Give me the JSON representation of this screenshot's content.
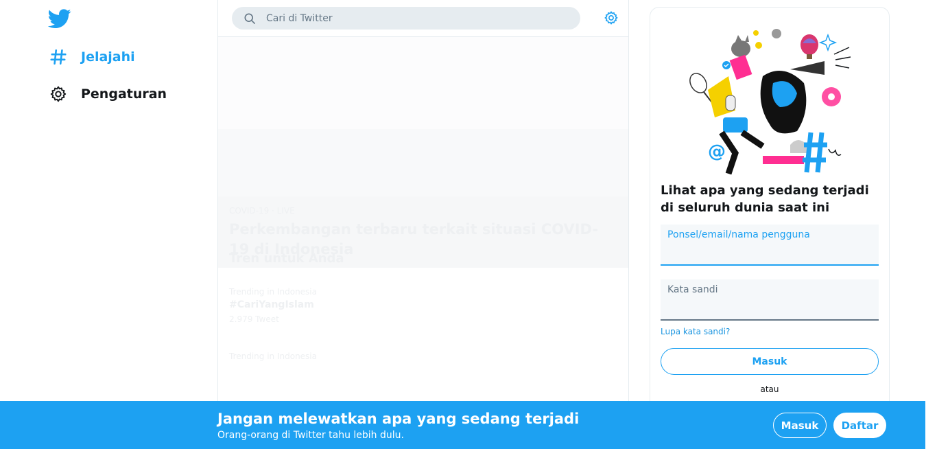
{
  "nav": {
    "items": [
      {
        "label": "Jelajahi",
        "icon": "hashtag-icon"
      },
      {
        "label": "Pengaturan",
        "icon": "gear-icon"
      }
    ]
  },
  "search": {
    "placeholder": "Cari di Twitter"
  },
  "main": {
    "hero_category": "COVID-19 · LIVE",
    "hero_title": "Perkembangan terbaru terkait situasi COVID-19 di Indonesia",
    "trends_heading": "Tren untuk Anda",
    "trend1_meta": "Trending in Indonesia",
    "trend1_name": "#CariYangIslam",
    "trend1_count": "2.979 Tweet",
    "trend2_meta": "Trending in Indonesia"
  },
  "login": {
    "heading": "Lihat apa yang sedang terjadi di seluruh dunia saat ini",
    "username_label": "Ponsel/email/nama pengguna",
    "password_label": "Kata sandi",
    "forgot": "Lupa kata sandi?",
    "submit": "Masuk",
    "or": "atau"
  },
  "banner": {
    "title": "Jangan melewatkan apa yang sedang terjadi",
    "subtitle": "Orang-orang di Twitter tahu lebih dulu.",
    "login": "Masuk",
    "signup": "Daftar"
  },
  "colors": {
    "accent": "#1da1f2",
    "text": "#14171a",
    "muted": "#657786",
    "border": "#e6ecf0"
  }
}
